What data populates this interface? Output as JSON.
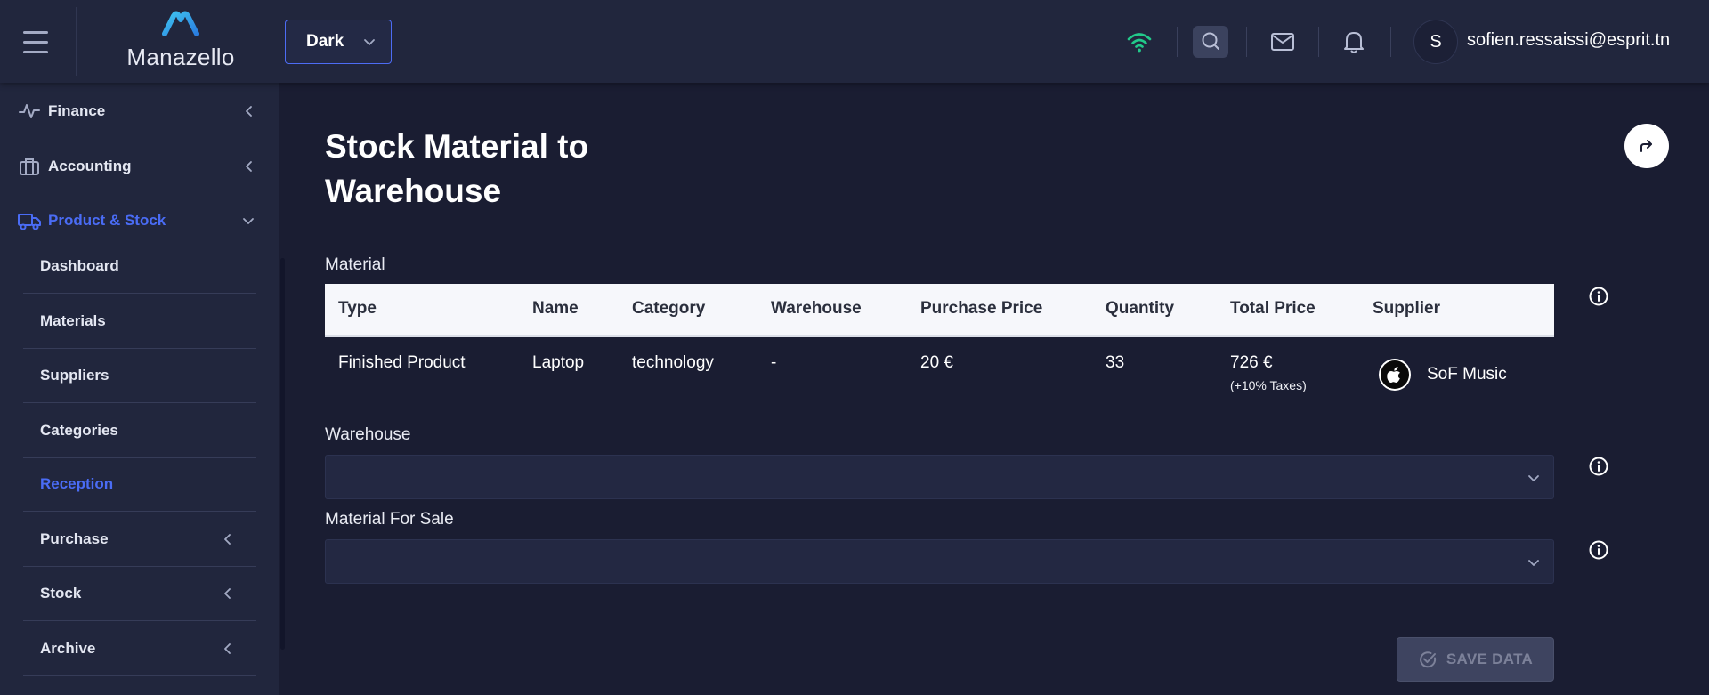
{
  "topbar": {
    "logo_text": "Manazello",
    "theme_select": "Dark",
    "user_initial": "S",
    "user_email": "sofien.ressaissi@esprit.tn"
  },
  "sidebar": {
    "items": [
      {
        "label": "Finance",
        "icon": "activity-icon"
      },
      {
        "label": "Accounting",
        "icon": "briefcase-icon"
      },
      {
        "label": "Product & Stock",
        "icon": "truck-icon"
      }
    ],
    "sub_items": [
      {
        "label": "Dashboard"
      },
      {
        "label": "Materials"
      },
      {
        "label": "Suppliers"
      },
      {
        "label": "Categories"
      },
      {
        "label": "Reception"
      },
      {
        "label": "Purchase"
      },
      {
        "label": "Stock"
      },
      {
        "label": "Archive"
      }
    ]
  },
  "main": {
    "title": "Stock Material to Warehouse",
    "material_label": "Material",
    "warehouse_label": "Warehouse",
    "material_for_sale_label": "Material For Sale",
    "save_label": "SAVE DATA",
    "table": {
      "headers": [
        "Type",
        "Name",
        "Category",
        "Warehouse",
        "Purchase Price",
        "Quantity",
        "Total Price",
        "Supplier"
      ],
      "row": {
        "type": "Finished Product",
        "name": "Laptop",
        "category": "technology",
        "warehouse": "-",
        "purchase_price": "20 €",
        "quantity": "33",
        "total_price": "726 €",
        "taxes_note": "(+10% Taxes)",
        "supplier": "SoF Music"
      }
    }
  },
  "colors": {
    "background": "#1a1d32",
    "panel": "#21263d",
    "accent": "#4a6cf5",
    "wifi": "#22c98a"
  }
}
